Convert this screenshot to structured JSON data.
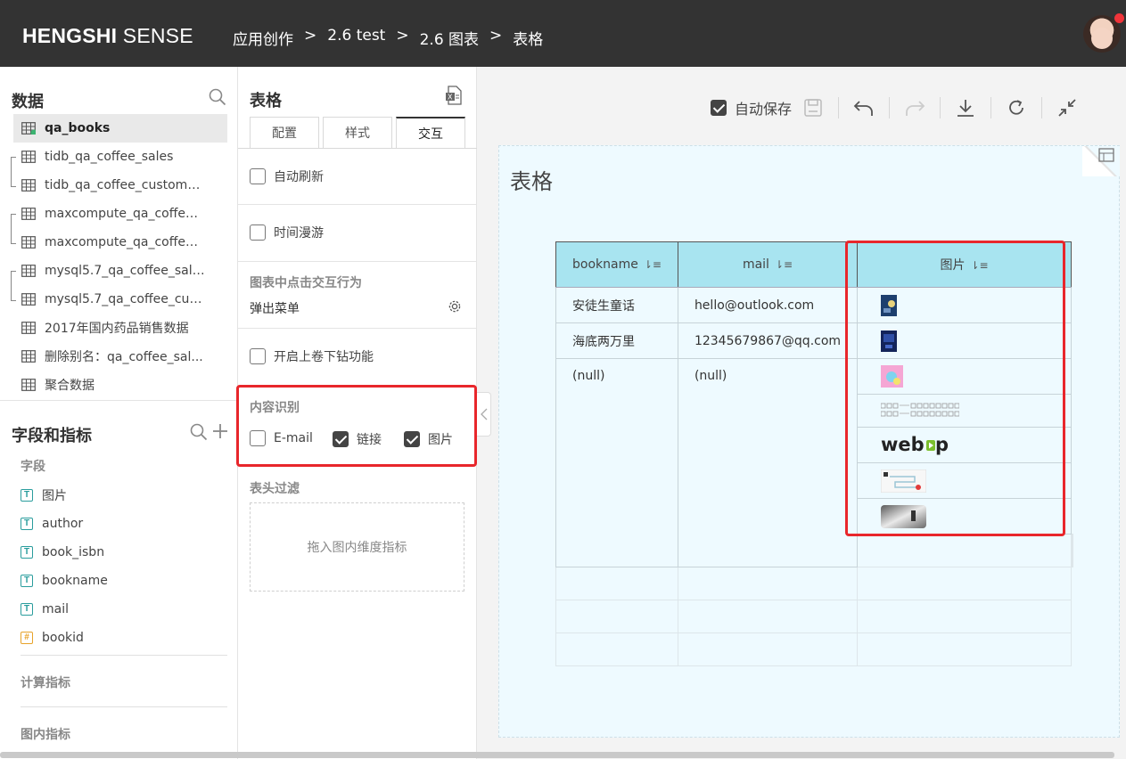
{
  "header": {
    "brand_bold": "HENGSHI",
    "brand_rest": " SENSE",
    "breadcrumbs": [
      "应用创作",
      "2.6 test",
      "2.6 图表",
      "表格"
    ],
    "sep": ">"
  },
  "data_panel": {
    "title": "数据",
    "datasets": [
      {
        "label": "qa_books",
        "active": true
      },
      {
        "label": "tidb_qa_coffee_sales"
      },
      {
        "label": "tidb_qa_coffee_custome..."
      },
      {
        "label": "maxcompute_qa_coffee_..."
      },
      {
        "label": "maxcompute_qa_coffee_..."
      },
      {
        "label": "mysql5.7_qa_coffee_sales"
      },
      {
        "label": "mysql5.7_qa_coffee_cust..."
      },
      {
        "label": "2017年国内药品销售数据"
      },
      {
        "label": "删除别名：qa_coffee_sal..."
      },
      {
        "label": "聚合数据"
      }
    ]
  },
  "fields_panel": {
    "title": "字段和指标",
    "fields_label": "字段",
    "fields": [
      {
        "label": "图片",
        "type": "T"
      },
      {
        "label": "author",
        "type": "T"
      },
      {
        "label": "book_isbn",
        "type": "T"
      },
      {
        "label": "bookname",
        "type": "T"
      },
      {
        "label": "mail",
        "type": "T"
      },
      {
        "label": "bookid",
        "type": "#"
      }
    ],
    "calc_label": "计算指标",
    "inchart_label": "图内指标"
  },
  "settings": {
    "title": "表格",
    "tabs": [
      "配置",
      "样式",
      "交互"
    ],
    "active_tab": "交互",
    "auto_refresh": "自动刷新",
    "time_roam": "时间漫游",
    "click_action_label": "图表中点击交互行为",
    "click_action_value": "弹出菜单",
    "drill": "开启上卷下钻功能",
    "content_recognition": "内容识别",
    "cr_email": "E-mail",
    "cr_link": "链接",
    "cr_image": "图片",
    "header_filter": "表头过滤",
    "dropzone": "拖入图内维度指标"
  },
  "toolbar": {
    "autosave": "自动保存"
  },
  "canvas": {
    "chart_title": "表格",
    "columns": [
      "bookname",
      "mail",
      "图片"
    ],
    "rows": [
      {
        "bookname": "安徒生童话",
        "mail": "hello@outlook.com"
      },
      {
        "bookname": "海底两万里",
        "mail": "12345679867@qq.com"
      },
      {
        "bookname": "(null)",
        "mail": "(null)"
      }
    ],
    "webp_logo": "webp"
  },
  "colors": {
    "topbar": "#333333",
    "header_cell": "#a8e4f0",
    "highlight": "#e8262b",
    "card_bg": "#eefaff"
  }
}
